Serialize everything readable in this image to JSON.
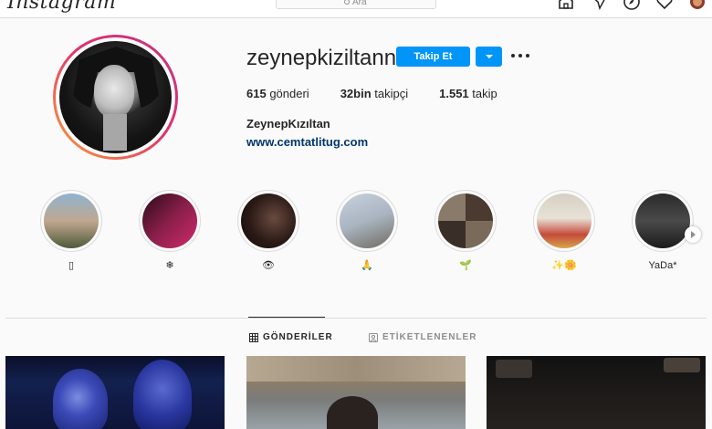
{
  "nav": {
    "logo": "Instagram",
    "search_placeholder": "Ara"
  },
  "profile": {
    "username": "zeynepkiziltann",
    "follow_label": "Takip Et",
    "stats": {
      "posts_count": "615",
      "posts_label": " gönderi",
      "followers_count": "32bin",
      "followers_label": " takipçi",
      "following_count": "1.551",
      "following_label": " takip"
    },
    "full_name": "ZeynepKızıltan",
    "website": "www.cemtatlitug.com"
  },
  "highlights": [
    {
      "label": "▯"
    },
    {
      "label": "❄"
    },
    {
      "label": "👁"
    },
    {
      "label": "🙏"
    },
    {
      "label": "🌱"
    },
    {
      "label": "✨🌼"
    },
    {
      "label": "YaDa*"
    }
  ],
  "tabs": {
    "posts": "GÖNDERİLER",
    "tagged": "ETİKETLENENLER"
  },
  "colors": {
    "accent": "#0095f6",
    "link": "#00376b",
    "text": "#262626",
    "muted": "#8e8e8e"
  }
}
